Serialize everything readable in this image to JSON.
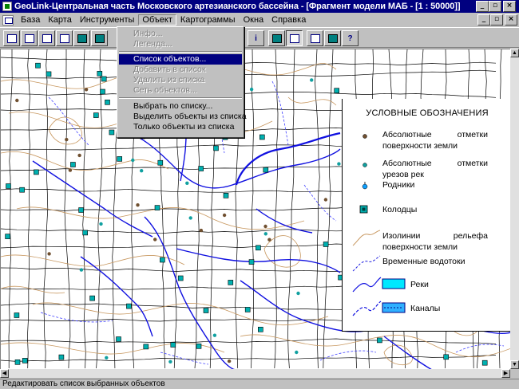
{
  "window": {
    "title": "GeoLink-Центральная часть Московского артезианского бассейна - [Фрагмент модели МАБ - [1 : 50000]]",
    "controls": [
      "_",
      "▫",
      "×"
    ]
  },
  "menu": [
    "База",
    "Карта",
    "Инструменты",
    "Объект",
    "Картограммы",
    "Окна",
    "Справка"
  ],
  "dropdown": {
    "items": [
      {
        "label": "Инфо...",
        "enabled": false
      },
      {
        "label": "Легенда...",
        "enabled": false
      },
      {
        "label": "Список объектов...",
        "enabled": true,
        "highlighted": true
      },
      {
        "label": "Добавить в список",
        "enabled": false
      },
      {
        "label": "Удалить из списка",
        "enabled": false
      },
      {
        "label": "Сеть объектов...",
        "enabled": false
      },
      {
        "label": "Выбрать по списку...",
        "enabled": true
      },
      {
        "label": "Выделить объекты из списка",
        "enabled": true
      },
      {
        "label": "Только объекты из списка",
        "enabled": true
      }
    ]
  },
  "legend": {
    "title": "УСЛОВНЫЕ ОБОЗНАЧЕНИЯ",
    "items": [
      {
        "label": "Абсолютные отметки поверхности земли",
        "symbol": "brown-dot-icon"
      },
      {
        "label": "Абсолютные отметки урезов рек",
        "symbol": "teal-dot-icon"
      },
      {
        "label": "Родники",
        "symbol": "spring-icon"
      },
      {
        "label": "Колодцы",
        "symbol": "well-square-icon"
      },
      {
        "label": "Изолинии рельефа поверхности земли",
        "symbol": "contour-line-icon"
      },
      {
        "label": "Временные водотоки",
        "symbol": "dashed-stream-icon"
      },
      {
        "label": "Реки",
        "symbol": "river-icon"
      },
      {
        "label": "Каналы",
        "symbol": "canal-icon"
      }
    ]
  },
  "status": "Редактировать список выбранных объектов",
  "colors": {
    "title_bar": "#000080",
    "river": "#1010e0",
    "contour": "#c89860",
    "grid": "#000000",
    "well": "#00a0a0"
  }
}
